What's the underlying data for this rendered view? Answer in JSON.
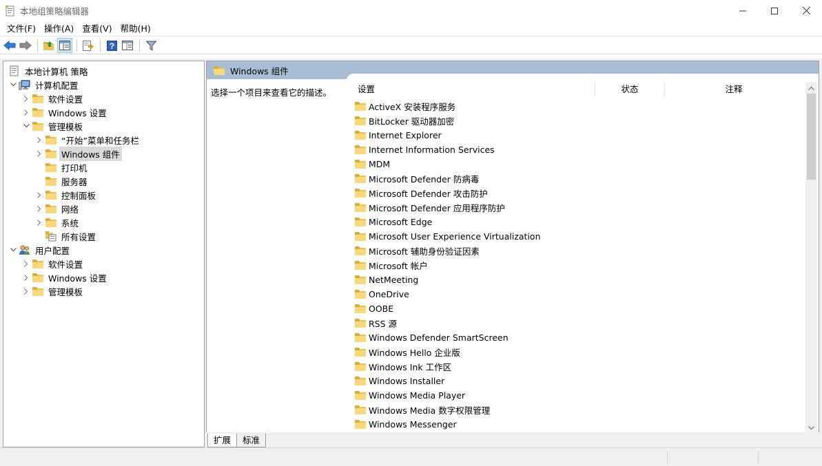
{
  "window": {
    "title": "本地组策略编辑器",
    "minimize_icon": "minimize-icon",
    "maximize_icon": "maximize-icon",
    "close_icon": "close-icon"
  },
  "menu": [
    "文件(F)",
    "操作(A)",
    "查看(V)",
    "帮助(H)"
  ],
  "toolbar": {
    "icons": [
      "back-arrow-icon",
      "forward-arrow-icon",
      "up-folder-icon",
      "show-hide-tree-icon",
      "export-list-icon",
      "help-icon",
      "properties-icon",
      "filter-icon"
    ]
  },
  "tree": {
    "items": [
      {
        "label": "本地计算机 策略",
        "depth": 0,
        "expander": "none",
        "icon": "policy-icon"
      },
      {
        "label": "计算机配置",
        "depth": 1,
        "expander": "expanded",
        "icon": "computer-icon"
      },
      {
        "label": "软件设置",
        "depth": 2,
        "expander": "collapsed",
        "icon": "folder-icon"
      },
      {
        "label": "Windows 设置",
        "depth": 2,
        "expander": "collapsed",
        "icon": "folder-icon"
      },
      {
        "label": "管理模板",
        "depth": 2,
        "expander": "expanded",
        "icon": "folder-icon"
      },
      {
        "label": "“开始”菜单和任务栏",
        "depth": 3,
        "expander": "collapsed",
        "icon": "folder-icon"
      },
      {
        "label": "Windows 组件",
        "depth": 3,
        "expander": "collapsed",
        "icon": "folder-open-icon",
        "selected": true
      },
      {
        "label": "打印机",
        "depth": 3,
        "expander": "none",
        "icon": "folder-icon"
      },
      {
        "label": "服务器",
        "depth": 3,
        "expander": "none",
        "icon": "folder-icon"
      },
      {
        "label": "控制面板",
        "depth": 3,
        "expander": "collapsed",
        "icon": "folder-icon"
      },
      {
        "label": "网络",
        "depth": 3,
        "expander": "collapsed",
        "icon": "folder-icon"
      },
      {
        "label": "系统",
        "depth": 3,
        "expander": "collapsed",
        "icon": "folder-icon"
      },
      {
        "label": "所有设置",
        "depth": 3,
        "expander": "none",
        "icon": "all-settings-icon"
      },
      {
        "label": "用户配置",
        "depth": 1,
        "expander": "expanded",
        "icon": "user-icon"
      },
      {
        "label": "软件设置",
        "depth": 2,
        "expander": "collapsed",
        "icon": "folder-icon"
      },
      {
        "label": "Windows 设置",
        "depth": 2,
        "expander": "collapsed",
        "icon": "folder-icon"
      },
      {
        "label": "管理模板",
        "depth": 2,
        "expander": "collapsed",
        "icon": "folder-icon"
      }
    ]
  },
  "right": {
    "header_title": "Windows 组件",
    "description": "选择一个项目来查看它的描述。",
    "columns": {
      "setting": "设置",
      "status": "状态",
      "note": "注释"
    },
    "items": [
      "ActiveX 安装程序服务",
      "BitLocker 驱动器加密",
      "Internet Explorer",
      "Internet Information Services",
      "MDM",
      "Microsoft Defender 防病毒",
      "Microsoft Defender 攻击防护",
      "Microsoft Defender 应用程序防护",
      "Microsoft Edge",
      "Microsoft User Experience Virtualization",
      "Microsoft 辅助身份验证因素",
      "Microsoft 帐户",
      "NetMeeting",
      "OneDrive",
      "OOBE",
      "RSS 源",
      "Windows Defender SmartScreen",
      "Windows Hello 企业版",
      "Windows Ink 工作区",
      "Windows Installer",
      "Windows Media Player",
      "Windows Media 数字权限管理",
      "Windows Messenger"
    ]
  },
  "tabs": [
    {
      "label": "扩展",
      "active": true
    },
    {
      "label": "标准",
      "active": false
    }
  ],
  "colors": {
    "header_band": "#a8bdd3",
    "selection": "#d9d9d9",
    "folder": "#f7d87c"
  }
}
